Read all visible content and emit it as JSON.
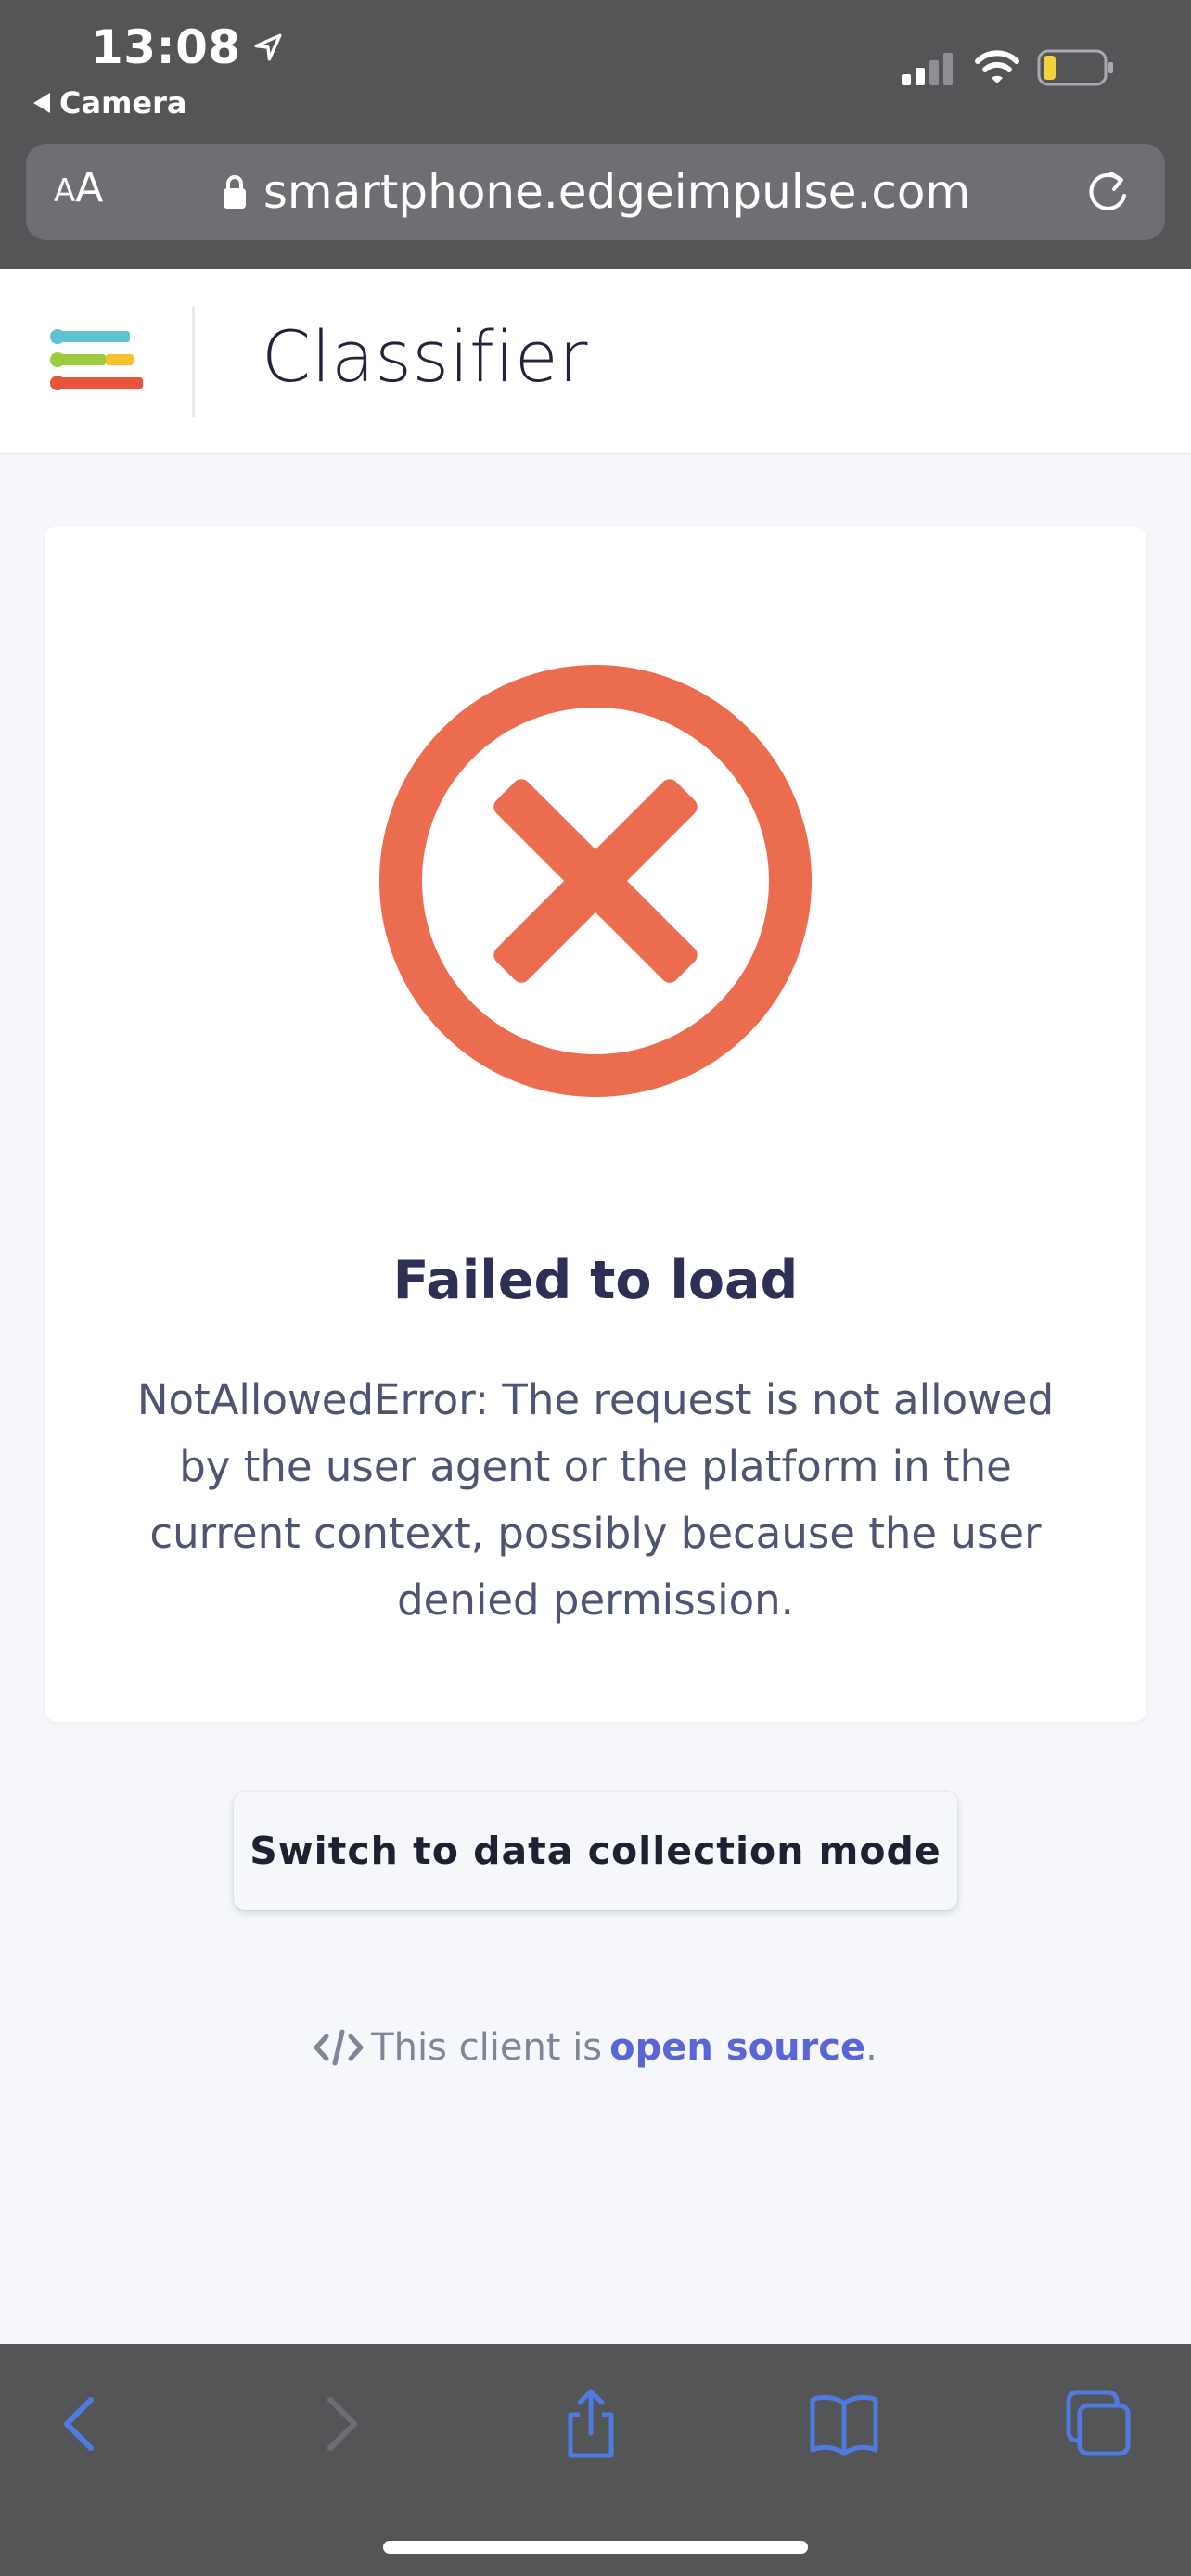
{
  "status_bar": {
    "time": "13:08",
    "back_app": "Camera"
  },
  "browser": {
    "aa_label_small": "A",
    "aa_label_large": "A",
    "url": "smartphone.edgeimpulse.com"
  },
  "header": {
    "title": "Classifier"
  },
  "error": {
    "title": "Failed to load",
    "message": "NotAllowedError: The request is not allowed by the user agent or the platform in the current context, possibly because the user denied permission."
  },
  "actions": {
    "switch_mode": "Switch to data collection mode"
  },
  "footer": {
    "prefix": "This client is",
    "link_text": "open source",
    "suffix": "."
  },
  "colors": {
    "error_red": "#eb6c4e",
    "chrome_gray": "#545557",
    "link_blue": "#5b66d6",
    "toolbar_blue": "#4f7be0"
  }
}
